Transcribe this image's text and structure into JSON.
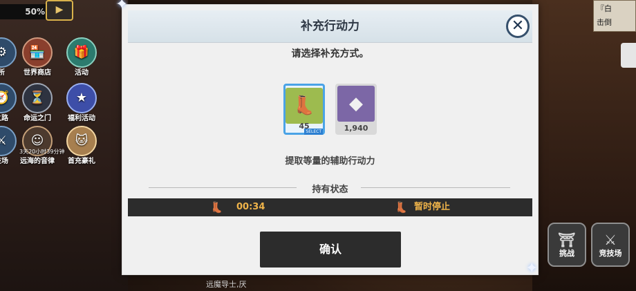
{
  "hud": {
    "percent": "50%",
    "video_icon": "video-icon"
  },
  "left_menu": [
    {
      "label": "所",
      "icon": "gear-icon"
    },
    {
      "label": "世界商店",
      "icon": "shop-icon"
    },
    {
      "label": "活动",
      "icon": "gift-icon"
    },
    {
      "label": "之路",
      "icon": "path-icon"
    },
    {
      "label": "命运之门",
      "icon": "clock-icon"
    },
    {
      "label": "福利活动",
      "icon": "star-icon"
    },
    {
      "label": "技场",
      "icon": "arena-icon"
    },
    {
      "label": "远海的音律",
      "icon": "character-icon"
    },
    {
      "label": "首充豪礼",
      "icon": "cat-character-icon"
    }
  ],
  "left_menu_timer": "3天20小时39分钟",
  "right_top": {
    "line1": "『白",
    "line2": "击倒"
  },
  "right_buttons": [
    {
      "label": "挑战",
      "icon": "arch-icon"
    },
    {
      "label": "竞技场",
      "icon": "swords-icon"
    }
  ],
  "dialog": {
    "title": "补充行动力",
    "close_label": "✕",
    "subtitle": "请选择补充方式。",
    "items": [
      {
        "name": "boot",
        "count": "45",
        "badge": "SELECT",
        "selected": true
      },
      {
        "name": "crystal",
        "count": "1,940",
        "selected": false
      }
    ],
    "description": "提取等量的辅助行动力",
    "status_heading": "持有状态",
    "status": {
      "timer": "00:34",
      "state": "暂时停止"
    },
    "confirm_label": "确认"
  },
  "footer": {
    "text": "远魔导士,厌"
  }
}
